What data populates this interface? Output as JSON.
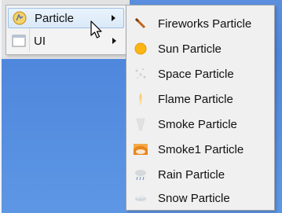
{
  "menu": {
    "items": [
      {
        "label": "Particle",
        "icon": "particle-icon",
        "has_submenu": true,
        "state": "hover"
      },
      {
        "label": "UI",
        "icon": "window-icon",
        "has_submenu": true
      }
    ]
  },
  "submenu": {
    "items": [
      {
        "label": "Fireworks Particle",
        "icon": "fireworks-icon"
      },
      {
        "label": "Sun Particle",
        "icon": "sun-icon"
      },
      {
        "label": "Space Particle",
        "icon": "space-icon"
      },
      {
        "label": "Flame Particle",
        "icon": "flame-icon"
      },
      {
        "label": "Smoke Particle",
        "icon": "smoke-icon"
      },
      {
        "label": "Smoke1 Particle",
        "icon": "smoke1-icon"
      },
      {
        "label": "Rain Particle",
        "icon": "rain-icon"
      },
      {
        "label": "Snow Particle",
        "icon": "snow-icon"
      }
    ]
  },
  "colors": {
    "background_blue": "#5b8fde",
    "menu_background": "#f3f3f3",
    "hover_background": "#dbe9f8",
    "hover_border": "#9fc0e4"
  }
}
